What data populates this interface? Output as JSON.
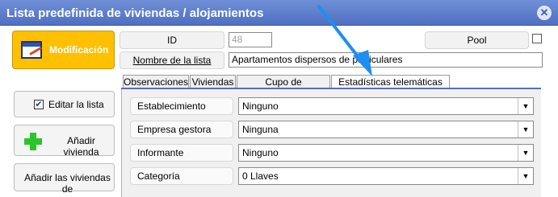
{
  "window": {
    "title": "Lista predefinida de viviendas / alojamientos",
    "close_icon": "close-icon"
  },
  "colors": {
    "titlebar": "#5b7fd0",
    "accent_button": "#ffc000",
    "arrow": "#1e8ff0"
  },
  "mode_button": {
    "label": "Modificación",
    "icon": "edit-document-icon"
  },
  "header": {
    "id_label": "ID",
    "id_value": "48",
    "pool_label": "Pool",
    "pool_checked": false,
    "name_label": "Nombre de la lista",
    "name_value": "Apartamentos dispersos de particulares"
  },
  "sidebar": {
    "edit_list_label": "Editar la lista",
    "edit_list_checked": true,
    "add_dwelling_label": "Añadir vivienda",
    "add_all_label": "Añadir las viviendas de"
  },
  "tabs": [
    {
      "label": "Observaciones",
      "active": false
    },
    {
      "label": "Viviendas",
      "active": false
    },
    {
      "label": "Cupo de disponibilidad",
      "active": false
    },
    {
      "label": "Estadísticas telemáticas INE",
      "active": true
    }
  ],
  "fields": [
    {
      "label": "Establecimiento",
      "value": "Ninguno"
    },
    {
      "label": "Empresa gestora",
      "value": "Ninguna"
    },
    {
      "label": "Informante",
      "value": "Ninguno"
    },
    {
      "label": "Categoría",
      "value": "0 Llaves"
    }
  ]
}
